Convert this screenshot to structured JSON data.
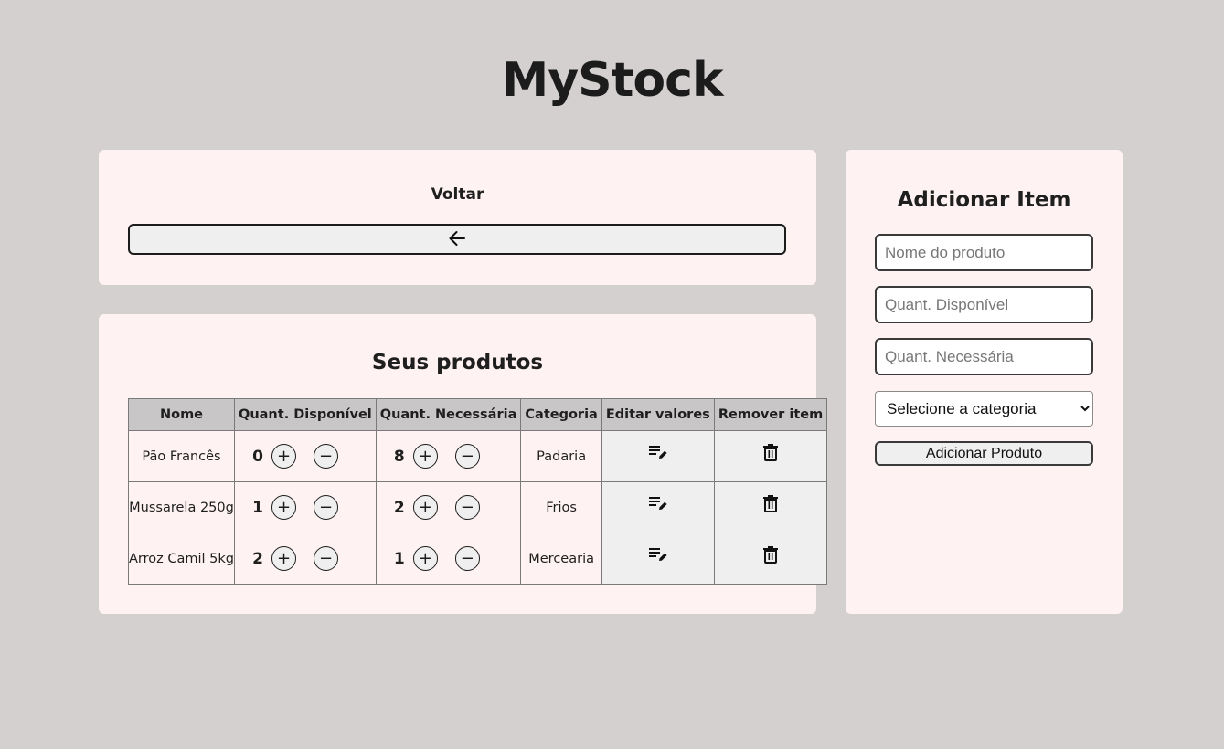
{
  "app": {
    "title": "MyStock"
  },
  "back": {
    "heading": "Voltar",
    "icon": "arrow-left-icon"
  },
  "products": {
    "heading": "Seus produtos",
    "columns": [
      "Nome",
      "Quant. Disponível",
      "Quant. Necessária",
      "Categoria",
      "Editar valores",
      "Remover item"
    ],
    "rows": [
      {
        "name": "Pão Francês",
        "available": "0",
        "needed": "8",
        "category": "Padaria"
      },
      {
        "name": "Mussarela 250g",
        "available": "1",
        "needed": "2",
        "category": "Frios"
      },
      {
        "name": "Arroz Camil 5kg",
        "available": "2",
        "needed": "1",
        "category": "Mercearia"
      }
    ],
    "plus_symbol": "+",
    "minus_symbol": "−"
  },
  "add_item": {
    "heading": "Adicionar Item",
    "name_placeholder": "Nome do produto",
    "available_placeholder": "Quant. Disponível",
    "needed_placeholder": "Quant. Necessária",
    "category_selected": "Selecione a categoria",
    "submit_label": "Adicionar Produto"
  }
}
